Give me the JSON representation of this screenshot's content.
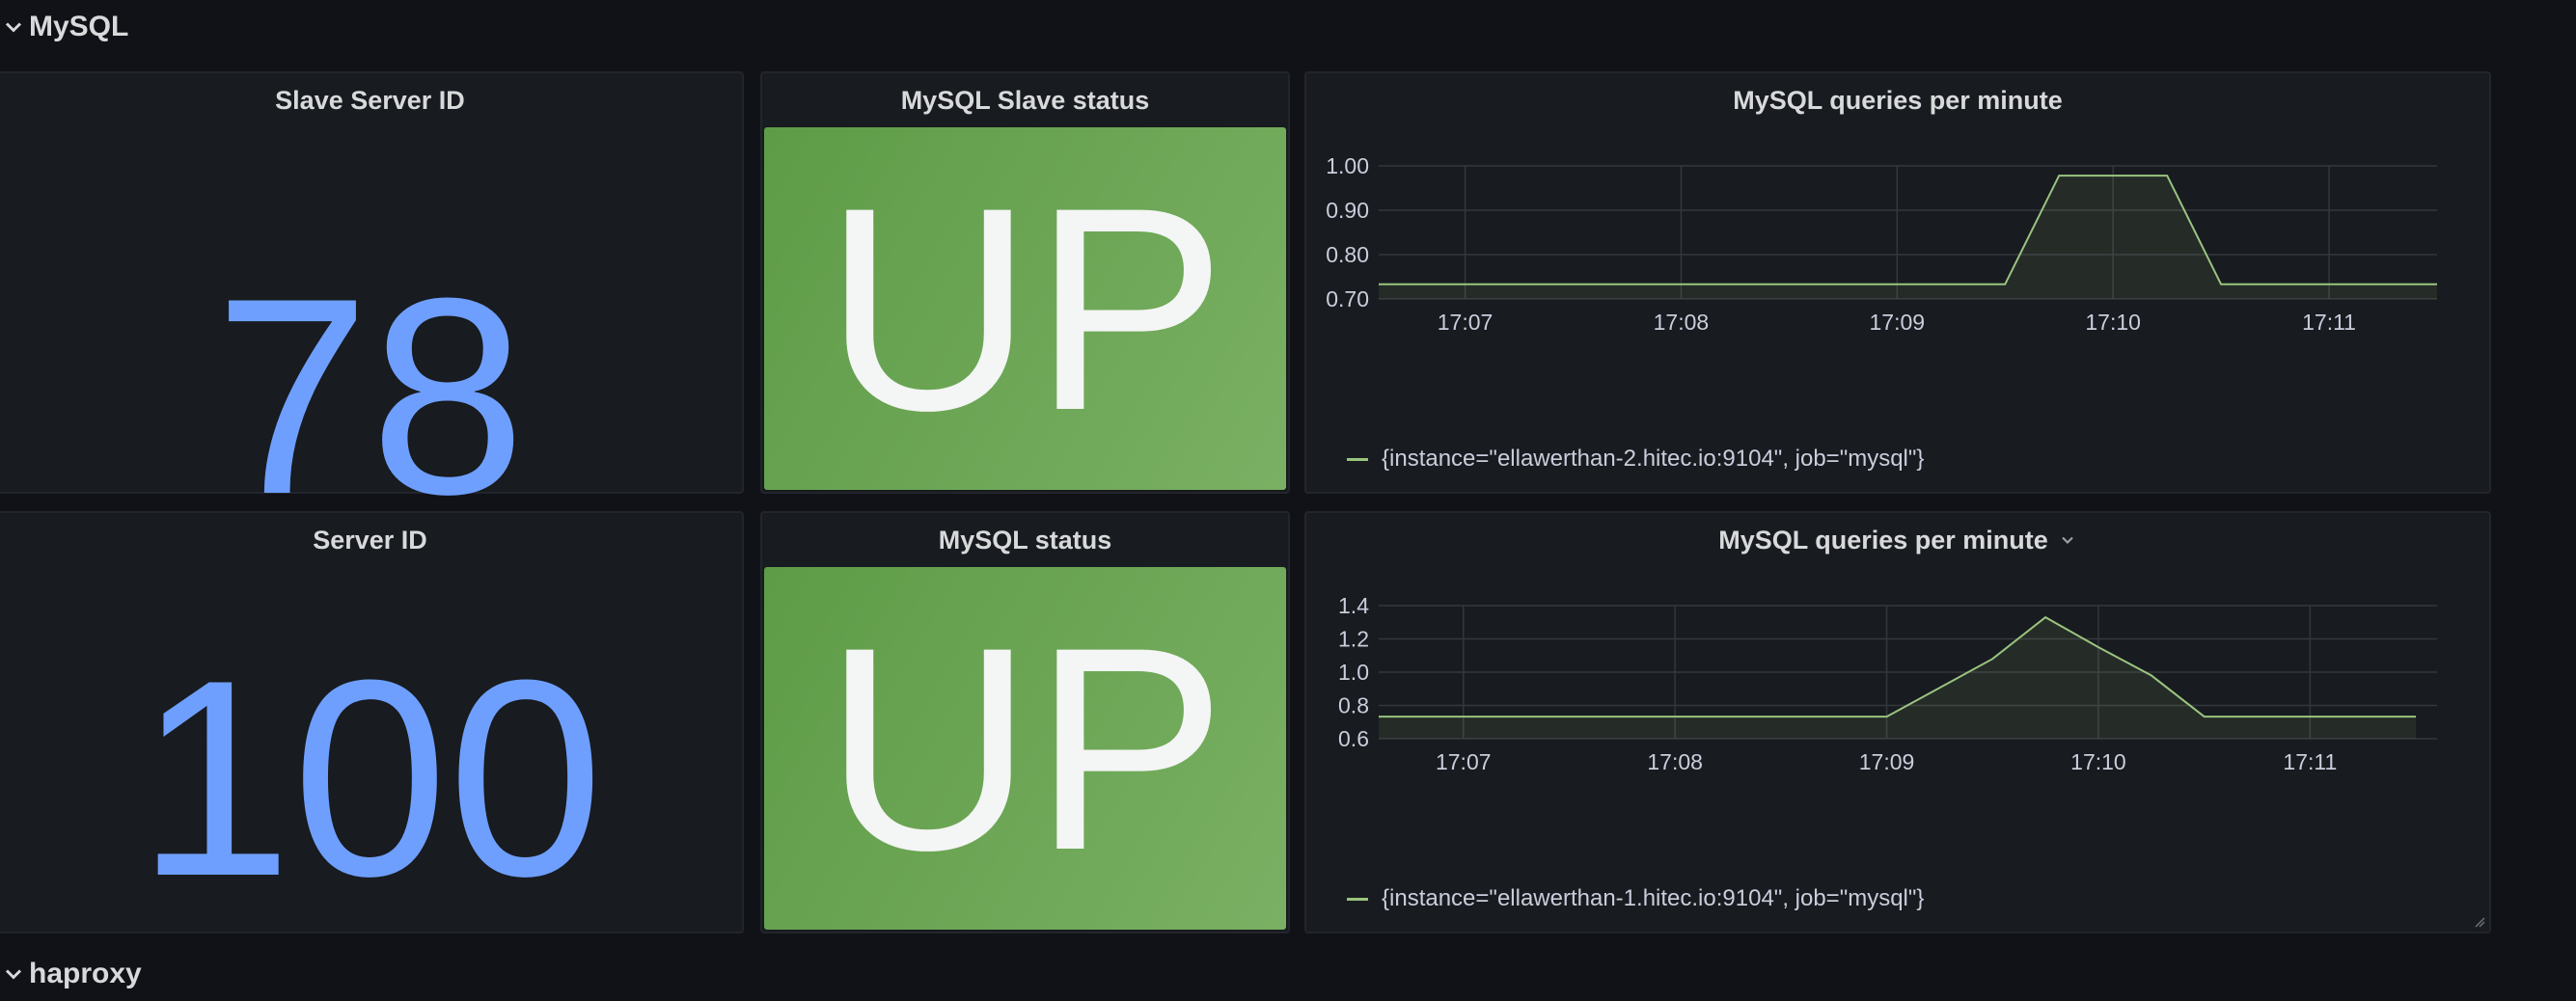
{
  "rows": {
    "mysql": {
      "title": "MySQL"
    },
    "haproxy": {
      "title": "haproxy"
    }
  },
  "panels": {
    "slave_server_id": {
      "title": "Slave Server ID",
      "value": "78"
    },
    "mysql_slave_status": {
      "title": "MySQL Slave status",
      "value": "UP"
    },
    "queries_slave": {
      "title": "MySQL queries per minute",
      "legend": "{instance=\"ellawerthan-2.hitec.io:9104\", job=\"mysql\"}"
    },
    "server_id": {
      "title": "Server ID",
      "value": "100"
    },
    "mysql_status": {
      "title": "MySQL status",
      "value": "UP"
    },
    "queries_master": {
      "title": "MySQL queries per minute",
      "legend": "{instance=\"ellawerthan-1.hitec.io:9104\", job=\"mysql\"}"
    }
  },
  "colors": {
    "stat_blue": "#6e9fff",
    "status_green": "#73a857",
    "series_green": "#9ac47f"
  },
  "chart_data": [
    {
      "type": "line",
      "x_tick_labels": [
        "17:07",
        "17:08",
        "17:09",
        "17:10",
        "17:11"
      ],
      "x_ticks": [
        7,
        8,
        9,
        10,
        11
      ],
      "xlim": [
        6.6,
        11.5
      ],
      "ylim": [
        0.7,
        1.0
      ],
      "y_ticks": [
        0.7,
        0.8,
        0.9,
        1.0
      ],
      "y_tick_labels": [
        "0.70",
        "0.80",
        "0.90",
        "1.00"
      ],
      "grid": true,
      "series": [
        {
          "name": "{instance=\"ellawerthan-2.hitec.io:9104\", job=\"mysql\"}",
          "x": [
            6.6,
            9.5,
            9.75,
            10.25,
            10.5,
            11.5
          ],
          "y": [
            0.733,
            0.733,
            0.978,
            0.978,
            0.733,
            0.733
          ]
        }
      ]
    },
    {
      "type": "line",
      "x_tick_labels": [
        "17:07",
        "17:08",
        "17:09",
        "17:10",
        "17:11"
      ],
      "x_ticks": [
        7,
        8,
        9,
        10,
        11
      ],
      "xlim": [
        6.6,
        11.6
      ],
      "ylim": [
        0.6,
        1.4
      ],
      "y_ticks": [
        0.6,
        0.8,
        1.0,
        1.2,
        1.4
      ],
      "y_tick_labels": [
        "0.6",
        "0.8",
        "1.0",
        "1.2",
        "1.4"
      ],
      "grid": true,
      "series": [
        {
          "name": "{instance=\"ellawerthan-1.hitec.io:9104\", job=\"mysql\"}",
          "x": [
            6.6,
            9.0,
            9.5,
            9.75,
            10.0,
            10.25,
            10.5,
            11.5
          ],
          "y": [
            0.733,
            0.733,
            1.08,
            1.33,
            1.15,
            0.98,
            0.733,
            0.733
          ]
        }
      ]
    }
  ]
}
